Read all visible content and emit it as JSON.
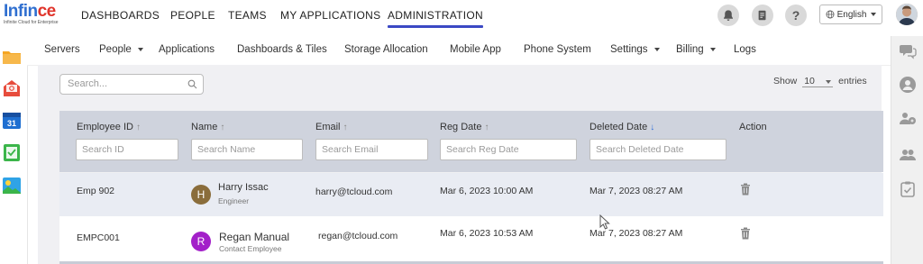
{
  "brand": {
    "name_part1": "Infin",
    "name_part2": "ce",
    "tagline": "Infinite Cloud for Enterprise"
  },
  "topnav": [
    {
      "label": "DASHBOARDS",
      "active": false
    },
    {
      "label": "PEOPLE",
      "active": false
    },
    {
      "label": "TEAMS",
      "active": false
    },
    {
      "label": "MY APPLICATIONS",
      "active": false
    },
    {
      "label": "ADMINISTRATION",
      "active": true
    }
  ],
  "topright": {
    "icons": [
      "bell-icon",
      "notes-icon",
      "help-icon"
    ],
    "help_glyph": "?",
    "language": "English",
    "accent_color": "#3b49c4"
  },
  "subnav": [
    {
      "label": "Servers",
      "dropdown": false
    },
    {
      "label": "People",
      "dropdown": true
    },
    {
      "label": "Applications",
      "dropdown": false
    },
    {
      "label": "Dashboards & Tiles",
      "dropdown": false
    },
    {
      "label": "Storage Allocation",
      "dropdown": false
    },
    {
      "label": "Mobile App",
      "dropdown": false
    },
    {
      "label": "Phone System",
      "dropdown": false
    },
    {
      "label": "Settings",
      "dropdown": true
    },
    {
      "label": "Billing",
      "dropdown": true
    },
    {
      "label": "Logs",
      "dropdown": false
    }
  ],
  "search": {
    "placeholder": "Search..."
  },
  "show_entries": {
    "prefix": "Show",
    "value": "10",
    "suffix": "entries"
  },
  "table": {
    "columns": [
      {
        "label": "Employee ID",
        "sort": "↑",
        "sort_active": false,
        "filter_placeholder": "Search ID"
      },
      {
        "label": "Name",
        "sort": "↑",
        "sort_active": false,
        "filter_placeholder": "Search Name"
      },
      {
        "label": "Email",
        "sort": "↑",
        "sort_active": false,
        "filter_placeholder": "Search Email"
      },
      {
        "label": "Reg Date",
        "sort": "↑",
        "sort_active": false,
        "filter_placeholder": "Search Reg Date"
      },
      {
        "label": "Deleted Date",
        "sort": "↓",
        "sort_active": true,
        "filter_placeholder": "Search Deleted Date"
      },
      {
        "label": "Action"
      }
    ],
    "rows": [
      {
        "employee_id": "Emp 902",
        "initial": "H",
        "avatar_color": "#8a6d3b",
        "name": "Harry Issac",
        "role": "Engineer",
        "email": "harry@tcloud.com",
        "reg_date": "Mar 6, 2023 10:00 AM",
        "deleted_date": "Mar 7, 2023 08:27 AM"
      },
      {
        "employee_id": "EMPC001",
        "initial": "R",
        "avatar_color": "#a320c9",
        "name": "Regan Manual",
        "role": "Contact Employee",
        "email": "regan@tcloud.com",
        "reg_date": "Mar 6, 2023 10:53 AM",
        "deleted_date": "Mar 7, 2023 08:27 AM"
      }
    ]
  }
}
